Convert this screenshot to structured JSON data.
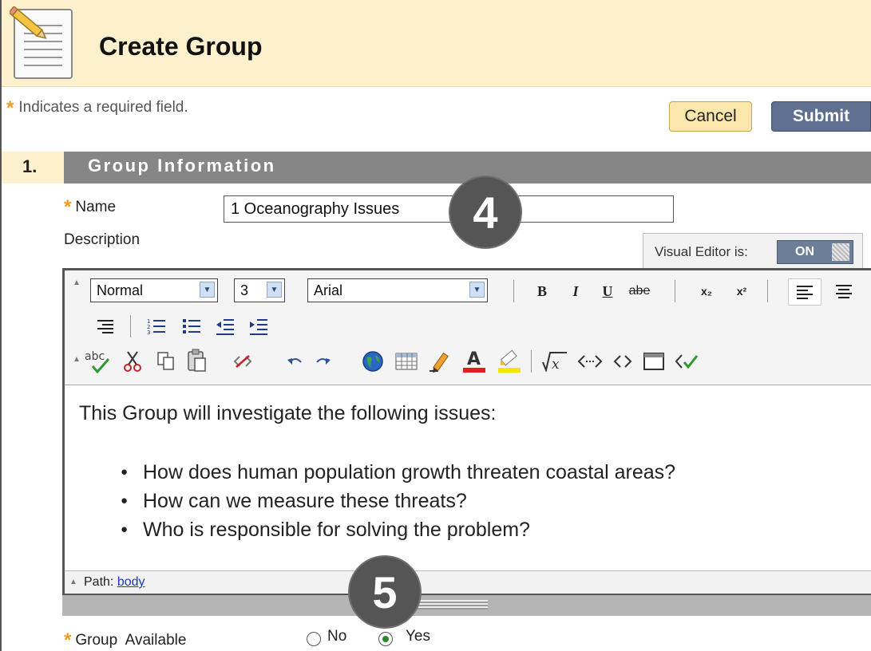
{
  "header": {
    "title": "Create Group",
    "icon": "document-pencil-icon"
  },
  "required_note": {
    "marker": "*",
    "text": "Indicates a required field."
  },
  "actions": {
    "cancel_label": "Cancel",
    "submit_label": "Submit"
  },
  "section": {
    "number": "1.",
    "title": "Group Information"
  },
  "name_field": {
    "label": "Name",
    "value": "1 Oceanography Issues",
    "required": true
  },
  "description_field": {
    "label": "Description"
  },
  "visual_editor": {
    "label": "Visual Editor is:",
    "state": "ON"
  },
  "toolbar": {
    "format_value": "Normal",
    "size_value": "3",
    "font_value": "Arial",
    "bold": "B",
    "italic": "I",
    "underline": "U",
    "strike": "abe",
    "subscript": "x₂",
    "superscript": "x²"
  },
  "editor_content": {
    "intro": "This Group will investigate the following issues:",
    "bullets": [
      "How does human population growth threaten coastal areas?",
      "How can we measure these threats?",
      "Who is responsible for solving the problem?"
    ]
  },
  "status": {
    "path_label": "Path:",
    "path_link": "body"
  },
  "callouts": [
    "4",
    "5"
  ],
  "availability": {
    "label": "Group  Available",
    "options": [
      "No",
      "Yes"
    ],
    "selected": "Yes"
  },
  "colors": {
    "required_star": "#f29b1d",
    "submit": "#5e6f90",
    "section_bar": "#868686",
    "header_bg": "#fdf0cd"
  }
}
